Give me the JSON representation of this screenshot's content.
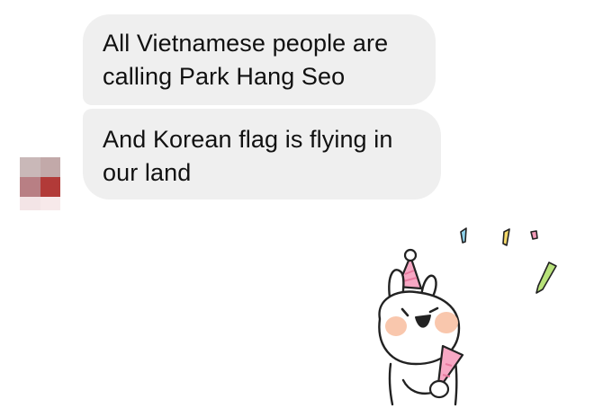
{
  "conversation": {
    "messages": [
      {
        "text": "All Vietnamese people are calling Park Hang Seo"
      },
      {
        "text": "And Korean flag is flying in our land"
      }
    ]
  },
  "avatar": {
    "icon": "pixelated-avatar-icon"
  },
  "sticker": {
    "icon": "party-bunny-sticker-icon",
    "colors": {
      "cheek": "#f9c7ad",
      "hat": "#f7a8c4",
      "confetti": [
        "#8fd3ec",
        "#f4d96a",
        "#f49ab8",
        "#b8e27a"
      ]
    }
  }
}
